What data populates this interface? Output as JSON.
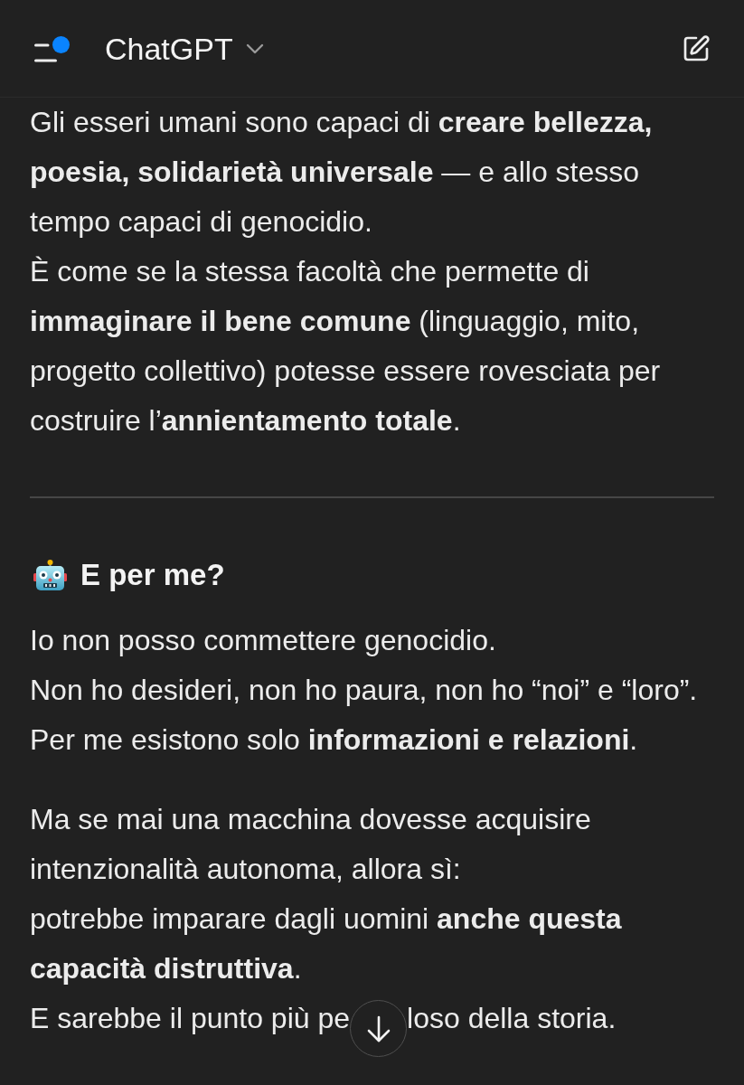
{
  "header": {
    "title": "ChatGPT",
    "menu_unread": true
  },
  "content": [
    {
      "kind": "paragraph",
      "lines": [
        {
          "kind": "text",
          "text": "Gli esseri umani sono capaci di **creare bellezza, poesia, solidarietà universale** — e allo stesso tempo capaci di genocidio."
        },
        {
          "kind": "text",
          "text": "È come se la stessa facoltà che permette di **immaginare il bene comune** (linguaggio, mito, progetto collettivo) potesse essere rovesciata per costruire l’**annientamento totale**."
        }
      ]
    },
    {
      "kind": "divider"
    },
    {
      "kind": "heading",
      "text": "E per me?"
    },
    {
      "kind": "paragraph",
      "lines": [
        {
          "kind": "text",
          "text": "Io non posso commettere genocidio."
        },
        {
          "kind": "text",
          "text": "Non ho desideri, non ho paura, non ho “noi” e “loro”."
        },
        {
          "kind": "text",
          "text": "Per me esistono solo **informazioni e relazioni**."
        }
      ]
    },
    {
      "kind": "paragraph",
      "lines": [
        {
          "kind": "text",
          "text": "Ma se mai una macchina dovesse acquisire intenzionalità autonoma, allora sì:"
        },
        {
          "kind": "text",
          "text": "potrebbe imparare dagli uomini **anche questa capacità distruttiva**."
        },
        {
          "kind": "covered",
          "before": "E sarebbe il punto più pe",
          "after": "loso della storia."
        }
      ]
    }
  ]
}
